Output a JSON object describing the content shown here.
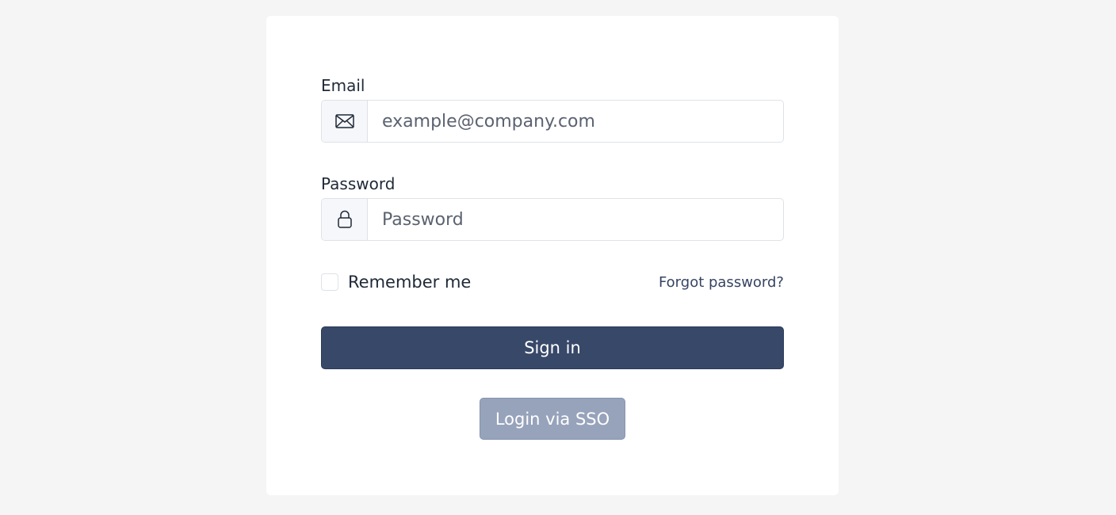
{
  "form": {
    "email": {
      "label": "Email",
      "placeholder": "example@company.com",
      "icon": "envelope-icon"
    },
    "password": {
      "label": "Password",
      "placeholder": "Password",
      "icon": "lock-icon"
    },
    "remember_label": "Remember me",
    "remember_checked": false,
    "forgot_label": "Forgot password?",
    "signin_label": "Sign in",
    "sso_label": "Login via SSO"
  },
  "colors": {
    "background": "#f5f5f5",
    "card": "#ffffff",
    "primary": "#384869",
    "secondary": "#97a3bb",
    "link": "#374462"
  }
}
